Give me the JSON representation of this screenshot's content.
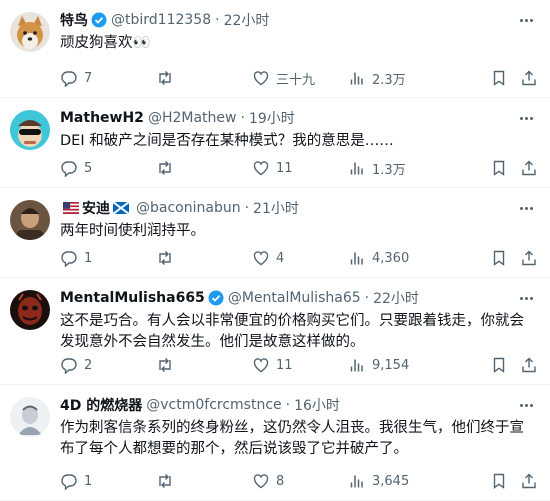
{
  "tweets": [
    {
      "name": "特鸟",
      "verified": true,
      "handle": "@tbird112358",
      "time": "22小时",
      "text": "顽皮狗喜欢👀",
      "replies": "7",
      "retweets": "",
      "likes": "三十九",
      "views": "2.3万",
      "avatar_color": "#c9a27a"
    },
    {
      "name": "MathewH2",
      "verified": false,
      "handle": "@H2Mathew",
      "time": "19小时",
      "text": "DEI 和破产之间是否存在某种模式？我的意思是……",
      "replies": "5",
      "retweets": "",
      "likes": "11",
      "views": "1.3万",
      "avatar_color": "#3fc6d8"
    },
    {
      "name": "安迪",
      "verified": false,
      "handle": "@baconinabun",
      "time": "21小时",
      "text": "两年时间使利润持平。",
      "replies": "1",
      "retweets": "",
      "likes": "4",
      "views": "4,360",
      "avatar_color": "#5a4636"
    },
    {
      "name": "MentalMulisha665",
      "verified": true,
      "handle": "@MentalMulisha65",
      "time": "22小时",
      "text": "这不是巧合。有人会以非常便宜的价格购买它们。只要跟着钱走，你就会发现意外不会自然发生。他们是故意这样做的。",
      "replies": "2",
      "retweets": "",
      "likes": "11",
      "views": "9,154",
      "avatar_color": "#7a2418"
    },
    {
      "name": "4D 的燃烧器",
      "verified": false,
      "handle": "@vctm0fcrcmstnce",
      "time": "16小时",
      "text": "作为刺客信条系列的终身粉丝，这仍然令人沮丧。我很生气，他们终于宣布了每个人都想要的那个，然后说该毁了它并破产了。",
      "replies": "1",
      "retweets": "",
      "likes": "8",
      "views": "3,645",
      "avatar_color": "#dfe3e8"
    }
  ],
  "colors": {
    "verified": "#1d9bf0",
    "muted": "#536471",
    "text": "#0f1419"
  }
}
